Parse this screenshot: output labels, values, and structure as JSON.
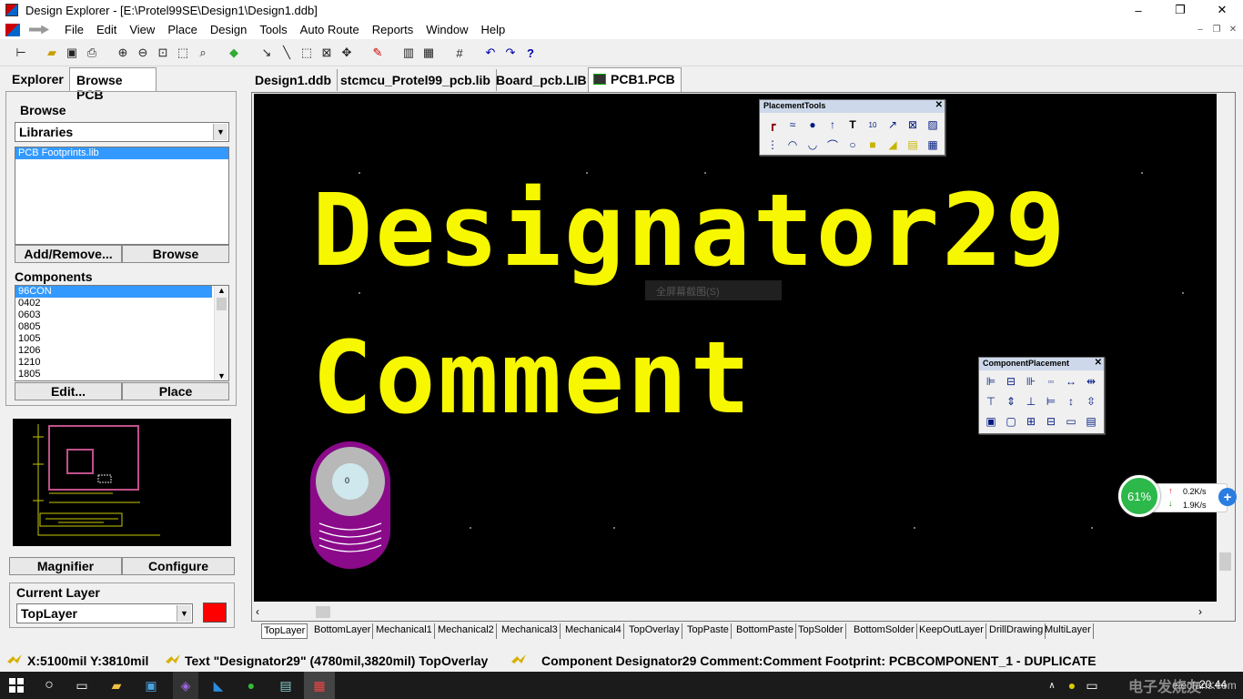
{
  "window": {
    "title": "Design Explorer - [E:\\Protel99SE\\Design1\\Design1.ddb]",
    "minimize": "–",
    "maximize": "❐",
    "close": "✕"
  },
  "menu": [
    "File",
    "Edit",
    "View",
    "Place",
    "Design",
    "Tools",
    "Auto Route",
    "Reports",
    "Window",
    "Help"
  ],
  "mdi_controls": {
    "minimize": "–",
    "restore": "❐",
    "close": "✕"
  },
  "toolbar_icons": [
    "hierarchy-icon",
    "open-icon",
    "save-icon",
    "print-icon",
    "zoom-in-icon",
    "zoom-out-icon",
    "fit-all-icon",
    "fit-area-icon",
    "zoom-points-icon",
    "cross-probe-icon",
    "interactive-route-icon",
    "interactive-wire-icon",
    "select-icon",
    "deselect-icon",
    "move-icon",
    "pencil-icon",
    "library-icon",
    "component-icon",
    "grid-icon",
    "undo-icon",
    "redo-icon",
    "help-icon"
  ],
  "left": {
    "tabs": [
      "Explorer",
      "Browse PCB"
    ],
    "browse_group": "Browse",
    "browse_combo": "Libraries",
    "libraries": [
      "PCB Footprints.lib"
    ],
    "add_remove": "Add/Remove...",
    "browse_btn": "Browse",
    "components_group": "Components",
    "components": [
      "96CON",
      "0402",
      "0603",
      "0805",
      "1005",
      "1206",
      "1210",
      "1805"
    ],
    "edit_btn": "Edit...",
    "place_btn": "Place",
    "magnifier_btn": "Magnifier",
    "configure_btn": "Configure",
    "current_layer_group": "Current Layer",
    "current_layer": "TopLayer",
    "layer_color": "#ff0000"
  },
  "doc_tabs": [
    "Design1.ddb",
    "stcmcu_Protel99_pcb.lib",
    "Board_pcb.LIB",
    "PCB1.PCB"
  ],
  "canvas": {
    "designator": "Designator29",
    "comment": "Comment",
    "pad_label": "0",
    "overlay_text": "全屏幕截图(S)",
    "text_color": "#f7f700"
  },
  "placement_tools": {
    "title": "PlacementTools",
    "close": "✕",
    "row1": [
      "track-icon",
      "arc-wire-icon",
      "via-icon",
      "string-param-icon",
      "string-icon",
      "coordinate-icon",
      "dimension-icon",
      "component-icon",
      "fill-pattern-icon"
    ],
    "row2": [
      "room-icon",
      "arc-center-icon",
      "arc-edge-icon",
      "arc-any-icon",
      "full-circle-icon",
      "fill-icon",
      "polygon-icon",
      "split-plane-icon",
      "array-paste-icon"
    ],
    "glyphs1": [
      "┏",
      "≈",
      "●",
      "↑",
      "T",
      "10",
      "↗",
      "⊠",
      "▨"
    ],
    "glyphs2": [
      "⋮",
      "◠",
      "◡",
      "⌒",
      "○",
      "■",
      "◢",
      "▤",
      "▦"
    ]
  },
  "component_placement": {
    "title": "ComponentPlacement",
    "close": "✕",
    "glyphs": [
      "⊫",
      "⊟",
      "⊪",
      "▫▫",
      "↔",
      "⇹",
      "⊤",
      "⇕",
      "⊥",
      "⊨",
      "↕",
      "⇳",
      "▣",
      "▢",
      "⊞",
      "⊟",
      "▭",
      "▤"
    ]
  },
  "layers": [
    "TopLayer",
    "BottomLayer",
    "Mechanical1",
    "Mechanical2",
    "Mechanical3",
    "Mechanical4",
    "TopOverlay",
    "TopPaste",
    "BottomPaste",
    "TopSolder",
    "BottomSolder",
    "KeepOutLayer",
    "DrillDrawing",
    "MultiLayer"
  ],
  "status": {
    "coords": "X:5100mil Y:3810mil",
    "text": "Text \"Designator29\" (4780mil,3820mil)  TopOverlay",
    "component": "Component Designator29 Comment:Comment Footprint: PCBCOMPONENT_1 - DUPLICATE"
  },
  "net_widget": {
    "percent": "61%",
    "up": "0.2K/s",
    "down": "1.9K/s"
  },
  "taskbar": {
    "time": "20:44",
    "watermark": "电子发烧友",
    "site": "elecfans.com"
  }
}
